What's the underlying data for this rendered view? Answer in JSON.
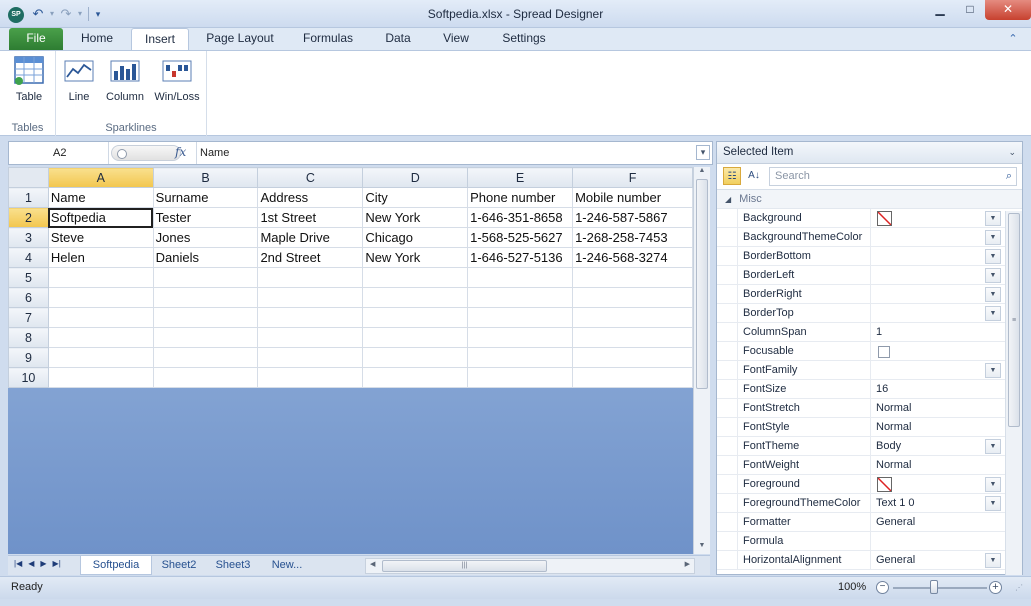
{
  "window": {
    "title": "Softpedia.xlsx - Spread Designer",
    "app_icon": "SP",
    "controls": [
      "minimize-icon",
      "maximize-icon",
      "close-icon"
    ]
  },
  "quick_access": [
    "save-icon",
    "undo-icon",
    "redo-icon",
    "customize-icon"
  ],
  "ribbon": {
    "tabs": [
      "File",
      "Home",
      "Insert",
      "Page Layout",
      "Formulas",
      "Data",
      "View",
      "Settings"
    ],
    "active_tab": "Insert",
    "groups": [
      {
        "label": "Tables",
        "buttons": [
          {
            "label": "Table",
            "icon": "table-icon"
          }
        ]
      },
      {
        "label": "Sparklines",
        "buttons": [
          {
            "label": "Line",
            "icon": "line-sparkline-icon"
          },
          {
            "label": "Column",
            "icon": "column-sparkline-icon"
          },
          {
            "label": "Win/Loss",
            "icon": "winloss-sparkline-icon"
          }
        ]
      }
    ]
  },
  "formula_bar": {
    "cell_ref": "A2",
    "fx": "fx",
    "value": "Name"
  },
  "grid": {
    "columns": [
      "A",
      "B",
      "C",
      "D",
      "E",
      "F"
    ],
    "selected_column": "A",
    "selected_row": "2",
    "rows": [
      {
        "num": "1",
        "cells": [
          "Name",
          "Surname",
          "Address",
          "City",
          "Phone number",
          "Mobile number"
        ]
      },
      {
        "num": "2",
        "cells": [
          "Softpedia",
          "Tester",
          "1st Street",
          "New York",
          "1-646-351-8658",
          "1-246-587-5867"
        ]
      },
      {
        "num": "3",
        "cells": [
          "Steve",
          "Jones",
          "Maple Drive",
          "Chicago",
          "1-568-525-5627",
          "1-268-258-7453"
        ]
      },
      {
        "num": "4",
        "cells": [
          "Helen",
          "Daniels",
          "2nd Street",
          "New York",
          "1-646-527-5136",
          "1-246-568-3274"
        ]
      },
      {
        "num": "5",
        "cells": [
          "",
          "",
          "",
          "",
          "",
          ""
        ]
      },
      {
        "num": "6",
        "cells": [
          "",
          "",
          "",
          "",
          "",
          ""
        ]
      },
      {
        "num": "7",
        "cells": [
          "",
          "",
          "",
          "",
          "",
          ""
        ]
      },
      {
        "num": "8",
        "cells": [
          "",
          "",
          "",
          "",
          "",
          ""
        ]
      },
      {
        "num": "9",
        "cells": [
          "",
          "",
          "",
          "",
          "",
          ""
        ]
      },
      {
        "num": "10",
        "cells": [
          "",
          "",
          "",
          "",
          "",
          ""
        ]
      }
    ]
  },
  "sheets": {
    "tabs": [
      "Softpedia",
      "Sheet2",
      "Sheet3",
      "New..."
    ],
    "active": "Softpedia"
  },
  "property_panel": {
    "title": "Selected Item",
    "search_placeholder": "Search",
    "category": "Misc",
    "properties": [
      {
        "name": "Background",
        "value": "",
        "kind": "swatch",
        "dropdown": true
      },
      {
        "name": "BackgroundThemeColor",
        "value": "",
        "kind": "text",
        "dropdown": true
      },
      {
        "name": "BorderBottom",
        "value": "",
        "kind": "text",
        "dropdown": true
      },
      {
        "name": "BorderLeft",
        "value": "",
        "kind": "text",
        "dropdown": true
      },
      {
        "name": "BorderRight",
        "value": "",
        "kind": "text",
        "dropdown": true
      },
      {
        "name": "BorderTop",
        "value": "",
        "kind": "text",
        "dropdown": true
      },
      {
        "name": "ColumnSpan",
        "value": "1",
        "kind": "text",
        "dropdown": false
      },
      {
        "name": "Focusable",
        "value": "",
        "kind": "checkbox",
        "dropdown": false
      },
      {
        "name": "FontFamily",
        "value": "",
        "kind": "text",
        "dropdown": true
      },
      {
        "name": "FontSize",
        "value": "16",
        "kind": "text",
        "dropdown": false
      },
      {
        "name": "FontStretch",
        "value": "Normal",
        "kind": "text",
        "dropdown": false
      },
      {
        "name": "FontStyle",
        "value": "Normal",
        "kind": "text",
        "dropdown": false
      },
      {
        "name": "FontTheme",
        "value": "Body",
        "kind": "text",
        "dropdown": true
      },
      {
        "name": "FontWeight",
        "value": "Normal",
        "kind": "text",
        "dropdown": false
      },
      {
        "name": "Foreground",
        "value": "",
        "kind": "swatch",
        "dropdown": true
      },
      {
        "name": "ForegroundThemeColor",
        "value": "Text 1 0",
        "kind": "text",
        "dropdown": true
      },
      {
        "name": "Formatter",
        "value": "General",
        "kind": "text",
        "dropdown": false
      },
      {
        "name": "Formula",
        "value": "",
        "kind": "text",
        "dropdown": false
      },
      {
        "name": "HorizontalAlignment",
        "value": "General",
        "kind": "text",
        "dropdown": true
      }
    ]
  },
  "status_bar": {
    "status": "Ready",
    "zoom": "100%"
  },
  "colors": {
    "file_tab": "#2e7d32",
    "selection_header": "#f2c64e",
    "grid_background": "#7f9fd2"
  }
}
